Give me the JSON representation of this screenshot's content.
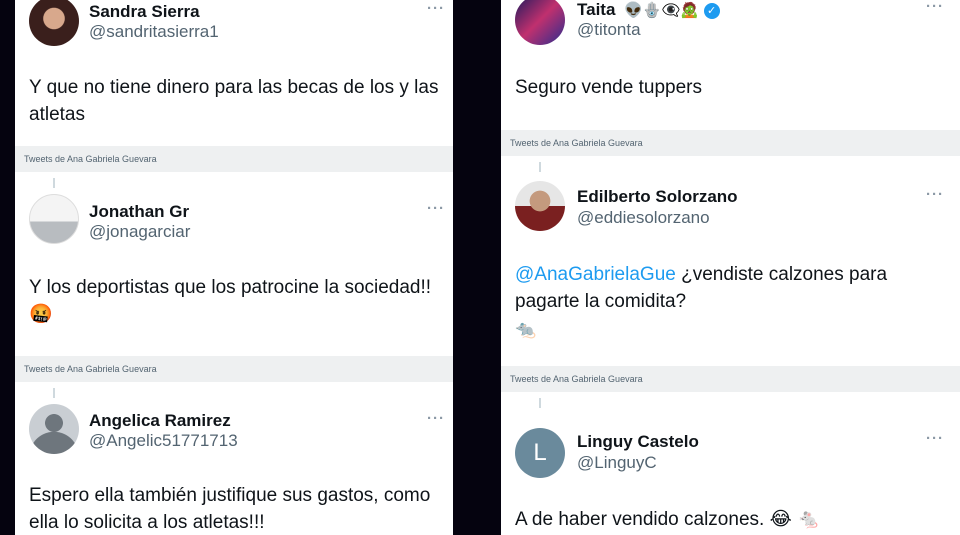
{
  "left": {
    "tweets": [
      {
        "name": "Sandra Sierra",
        "handle": "@sandritasierra1",
        "text": "Y que no tiene dinero para las becas de los y las atletas",
        "more": "···"
      },
      {
        "name": "Jonathan Gr",
        "handle": "@jonagarciar",
        "text": "Y los deportistas que los patrocine la sociedad!!",
        "emoji": "🤬",
        "more": "···"
      },
      {
        "name": "Angelica Ramirez",
        "handle": "@Angelic51771713",
        "text": "Espero ella también justifique sus gastos, como ella lo solicita a los atletas!!!",
        "more": "···"
      }
    ],
    "dividers": [
      "Tweets de Ana Gabriela Guevara",
      "Tweets de Ana Gabriela Guevara"
    ]
  },
  "right": {
    "tweets": [
      {
        "name": "Taita",
        "name_emojis": "👽🪬👁‍🗨🧟",
        "handle": "@titonta",
        "text": "Seguro vende tuppers",
        "more": "···"
      },
      {
        "name": "Edilberto Solorzano",
        "handle": "@eddiesolorzano",
        "mention": "@AnaGabrielaGue",
        "text": " ¿vendiste calzones para pagarte la comidita?",
        "emoji": "🐀",
        "more": "···"
      },
      {
        "name": "Linguy Castelo",
        "handle": "@LinguyC",
        "avatar_letter": "L",
        "text": "A de haber vendido calzones.",
        "emoji": "😂 🐁",
        "more": "···"
      }
    ],
    "dividers": [
      "Tweets de Ana Gabriela Guevara",
      "Tweets de Ana Gabriela Guevara"
    ]
  },
  "colors": {
    "accent": "#1d9bf0",
    "divider_bg": "#eef0f1",
    "handle": "#536471"
  }
}
